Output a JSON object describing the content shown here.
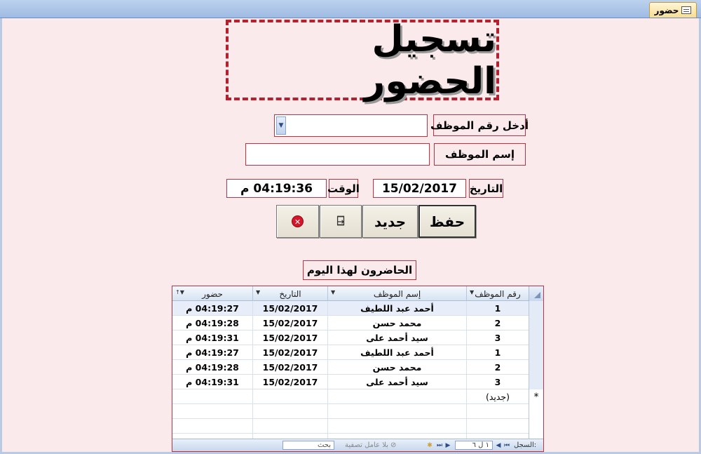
{
  "tab": {
    "title": "حضور"
  },
  "title": "تسجيل الحضور",
  "form": {
    "employee_number_label": "أدخل رقم الموظف",
    "employee_number_value": "",
    "employee_name_label": "إسم الموظف",
    "employee_name_value": "",
    "date_label": "التاريخ",
    "date_value": "15/02/2017",
    "time_label": "الوقت",
    "time_value": "04:19:36 م"
  },
  "buttons": {
    "save": "حفظ",
    "new": "جديد",
    "exit_icon": "exit-door-icon",
    "cancel_icon": "cancel-circle-icon",
    "cancel_glyph": "✕"
  },
  "attendees": {
    "section_label": "الحاضرون لهذا اليوم",
    "columns": [
      "رقم الموظف",
      "إسم الموظف",
      "التاريخ",
      "حضور"
    ],
    "rows": [
      {
        "number": "1",
        "name": "أحمد عبد اللطيف",
        "date": "15/02/2017",
        "time": "04:19:27 م"
      },
      {
        "number": "2",
        "name": "محمد حسن",
        "date": "15/02/2017",
        "time": "04:19:28 م"
      },
      {
        "number": "3",
        "name": "سيد أحمد على",
        "date": "15/02/2017",
        "time": "04:19:31 م"
      },
      {
        "number": "1",
        "name": "أحمد عبد اللطيف",
        "date": "15/02/2017",
        "time": "04:19:27 م"
      },
      {
        "number": "2",
        "name": "محمد حسن",
        "date": "15/02/2017",
        "time": "04:19:28 م"
      },
      {
        "number": "3",
        "name": "سيد أحمد على",
        "date": "15/02/2017",
        "time": "04:19:31 م"
      }
    ],
    "new_row_label": "(جديد)",
    "new_row_marker": "*"
  },
  "navigation": {
    "record_label": "السجل:",
    "record_position": "١ ل ٦",
    "filter_label": "بلا عامل تصفية",
    "search_placeholder": "بحث"
  },
  "colors": {
    "background": "#fbeaec",
    "border_accent": "#c6303e",
    "title_border": "#b5202f"
  }
}
